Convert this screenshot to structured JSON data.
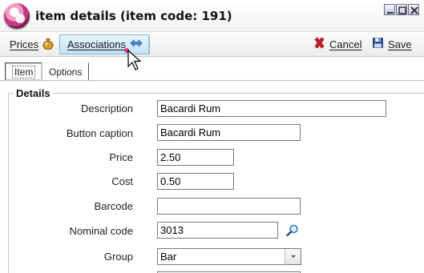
{
  "window": {
    "title": "item details (item code: 191)",
    "controls": [
      "minimize",
      "maximize",
      "close"
    ]
  },
  "toolbar": {
    "prices_label": "Prices",
    "associations_label": "Associations",
    "cancel_label": "Cancel",
    "save_label": "Save",
    "icons": {
      "prices": "money-bag-icon",
      "associations": "link-arrows-icon",
      "cancel": "red-x-icon",
      "save": "floppy-disk-icon"
    }
  },
  "tabs": [
    {
      "label": "Item",
      "selected": true
    },
    {
      "label": "Options",
      "selected": false
    }
  ],
  "details": {
    "legend": "Details",
    "fields": {
      "description": {
        "label": "Description",
        "value": "Bacardi Rum"
      },
      "button_caption": {
        "label": "Button caption",
        "value": "Bacardi Rum"
      },
      "price": {
        "label": "Price",
        "value": "2.50"
      },
      "cost": {
        "label": "Cost",
        "value": "0.50"
      },
      "barcode": {
        "label": "Barcode",
        "value": ""
      },
      "nominal_code": {
        "label": "Nominal code",
        "value": "3013"
      },
      "group": {
        "label": "Group",
        "value": "Bar"
      }
    }
  },
  "colors": {
    "associations_highlight": "#c4e3f5",
    "cancel_red": "#d0202a",
    "save_blue": "#2a4a8a",
    "money_gold": "#c8912a"
  }
}
